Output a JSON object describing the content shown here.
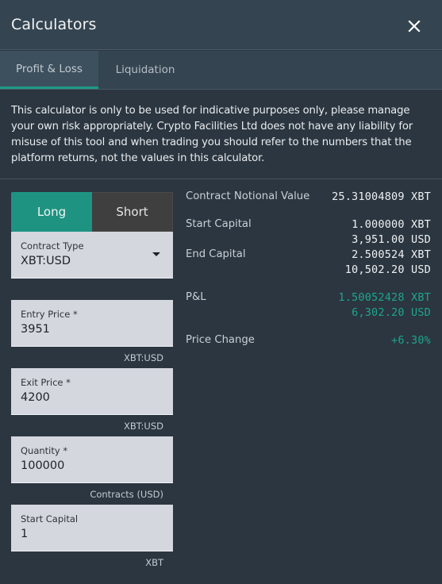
{
  "header": {
    "title": "Calculators",
    "close_icon": "close-icon"
  },
  "tabs": [
    {
      "label": "Profit & Loss",
      "active": true
    },
    {
      "label": "Liquidation",
      "active": false
    }
  ],
  "disclaimer": "This calculator is only to be used for indicative purposes only, please manage your own risk appropriately. Crypto Facilities Ltd does not have any liability for misuse of this tool and when trading you should refer to the numbers that the platform returns, not the values in this calculator.",
  "side": {
    "long_label": "Long",
    "short_label": "Short",
    "selected": "Long"
  },
  "form": {
    "contract_type": {
      "label": "Contract Type",
      "value": "XBT:USD"
    },
    "entry_price": {
      "label": "Entry Price *",
      "value": "3951",
      "unit": "XBT:USD"
    },
    "exit_price": {
      "label": "Exit Price *",
      "value": "4200",
      "unit": "XBT:USD"
    },
    "quantity": {
      "label": "Quantity *",
      "value": "100000",
      "unit": "Contracts (USD)"
    },
    "start_capital": {
      "label": "Start Capital",
      "value": "1",
      "unit": "XBT"
    }
  },
  "results": {
    "contract_notional_value": {
      "label": "Contract Notional Value",
      "value": "25.31004809 XBT"
    },
    "start_capital": {
      "label": "Start Capital",
      "xbt": "1.000000 XBT",
      "usd": "3,951.00 USD"
    },
    "end_capital": {
      "label": "End Capital",
      "xbt": "2.500524 XBT",
      "usd": "10,502.20 USD"
    },
    "pnl": {
      "label": "P&L",
      "xbt": "1.50052428 XBT",
      "usd": "6,302.20 USD"
    },
    "price_change": {
      "label": "Price Change",
      "value": "+6.30%"
    }
  },
  "colors": {
    "accent": "#1e9381",
    "positive": "#1fa58d",
    "background": "#2b3640",
    "header": "#344451"
  }
}
